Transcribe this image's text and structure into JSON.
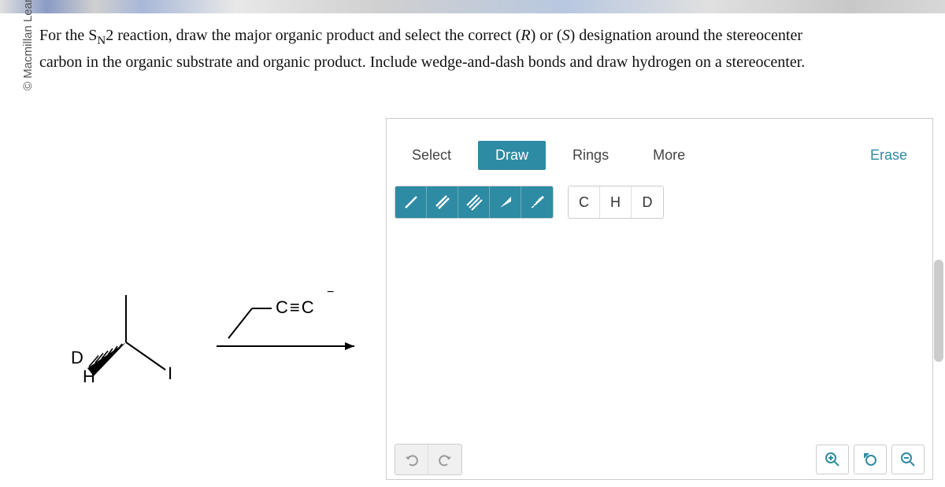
{
  "copyright": "© Macmillan Learning",
  "question": {
    "line1_prefix": "For the S",
    "line1_sub": "N",
    "line1_after_sub": "2 reaction, draw the major organic product and select the correct (",
    "line1_R": "R",
    "line1_or": ") or (",
    "line1_S": "S",
    "line1_suffix": ") designation around the stereocenter",
    "line2": "carbon in the organic substrate and organic product. Include wedge-and-dash bonds and draw hydrogen on a stereocenter."
  },
  "structure": {
    "label_D": "D",
    "label_H": "H",
    "label_I": "I",
    "nucleophile": "C≡C",
    "charge": "−"
  },
  "toolbar": {
    "select": "Select",
    "draw": "Draw",
    "rings": "Rings",
    "more": "More",
    "erase": "Erase"
  },
  "atoms": {
    "C": "C",
    "H": "H",
    "D": "D"
  }
}
